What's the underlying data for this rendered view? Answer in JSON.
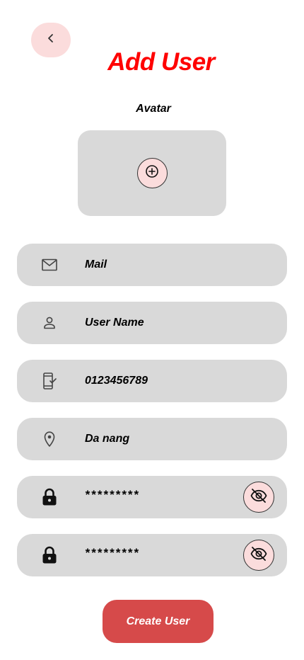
{
  "header": {
    "title": "Add User",
    "back_icon": "chevron-left-icon"
  },
  "avatar": {
    "label": "Avatar",
    "add_icon": "plus-circle-icon"
  },
  "form": {
    "mail": {
      "value": "Mail",
      "icon": "mail-icon"
    },
    "username": {
      "value": "User Name",
      "icon": "user-icon"
    },
    "phone": {
      "value": "0123456789",
      "icon": "phone-check-icon"
    },
    "location": {
      "value": "Da nang",
      "icon": "location-pin-icon"
    },
    "password": {
      "value": "*********",
      "icon": "lock-icon",
      "toggle_icon": "eye-off-icon"
    },
    "confirm_password": {
      "value": "*********",
      "icon": "lock-icon",
      "toggle_icon": "eye-off-icon"
    }
  },
  "actions": {
    "create_label": "Create User"
  },
  "colors": {
    "title": "#ff0000",
    "accent_soft": "#fbdcdc",
    "field_bg": "#d9d9d9",
    "button": "#d64a4a"
  }
}
